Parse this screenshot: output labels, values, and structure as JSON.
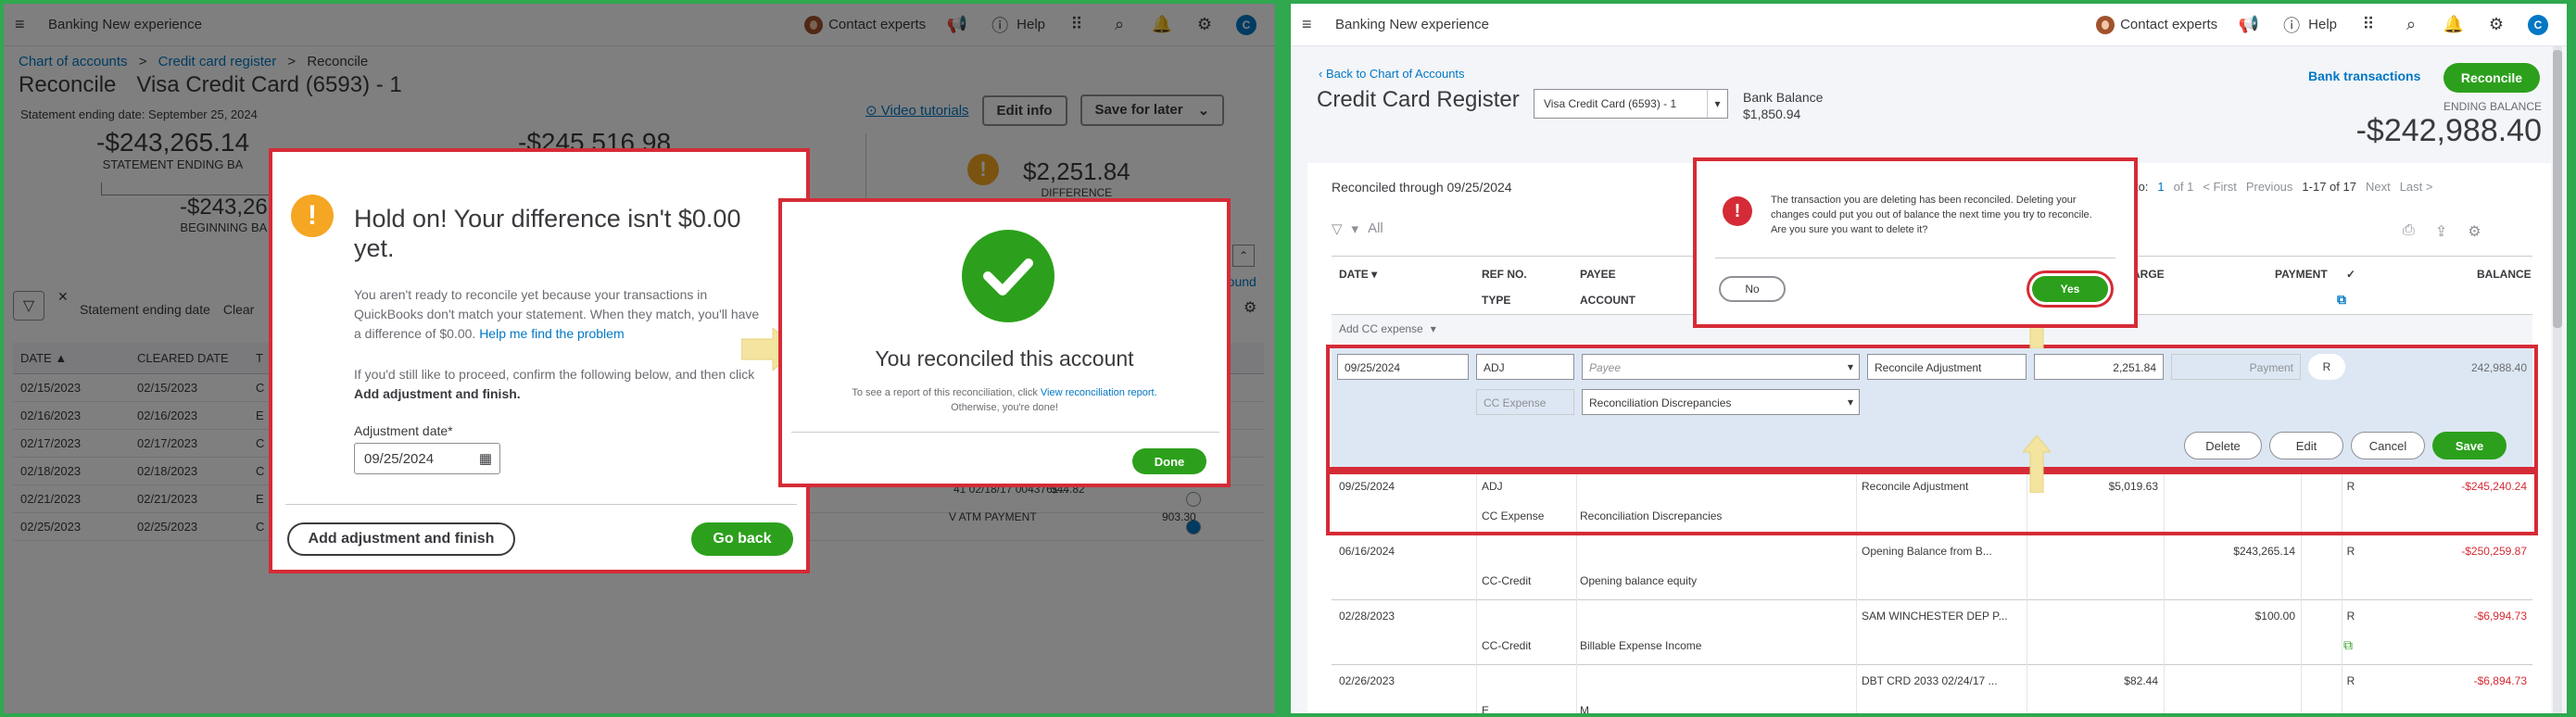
{
  "topbar": {
    "title": "Banking New experience",
    "contact": "Contact experts",
    "help": "Help",
    "avatar": "C"
  },
  "left": {
    "breadcrumb": {
      "a": "Chart of accounts",
      "sep": ">",
      "b": "Credit card register",
      "sep2": ">",
      "c": "Reconcile"
    },
    "title": "Reconcile",
    "account": "Visa Credit Card (6593) - 1",
    "stmt_date": "Statement ending date: September 25, 2024",
    "video": "Video tutorials",
    "edit_info": "Edit info",
    "save_later": "Save for later",
    "stmt_balance": "-$243,265.14",
    "stmt_balance_lbl": "STATEMENT ENDING BA",
    "cleared_balance": "-$245,516.98",
    "beginning": "-$243,26",
    "beginning_lbl": "BEGINNING BA",
    "difference": "$2,251.84",
    "difference_lbl": "DIFFERENCE",
    "filter_chip": "Statement ending date",
    "clear": "Clear",
    "round": "round",
    "cols": [
      "DATE ▲",
      "CLEARED DATE",
      "T"
    ],
    "rows": [
      [
        "02/15/2023",
        "02/15/2023",
        "C"
      ],
      [
        "02/16/2023",
        "02/16/2023",
        "E"
      ],
      [
        "02/17/2023",
        "02/17/2023",
        "C"
      ],
      [
        "02/18/2023",
        "02/18/2023",
        "C"
      ],
      [
        "02/21/2023",
        "02/21/2023",
        "E"
      ],
      [
        "02/25/2023",
        "02/25/2023",
        "C"
      ]
    ],
    "row_extra": [
      {
        "desc": "41 02/18/17 0043761...",
        "amt": "$44.82"
      },
      {
        "desc": "V ATM PAYMENT",
        "amt": "903.30"
      }
    ],
    "modal": {
      "heading": "Hold on! Your difference isn't $0.00 yet.",
      "p1": "You aren't ready to reconcile yet because your transactions in QuickBooks don't match your statement. When they match, you'll have a difference of $0.00.",
      "p1_link": "Help me find the problem",
      "p2a": "If you'd still like to proceed, confirm the following below, and then click",
      "p2b": "Add adjustment and finish.",
      "date_label": "Adjustment date*",
      "date_value": "09/25/2024",
      "btn_add": "Add adjustment and finish",
      "btn_back": "Go back"
    },
    "success": {
      "title": "You reconciled this account",
      "line1": "To see a report of this reconciliation, click",
      "link": "View reconciliation report.",
      "line2": "Otherwise, you're done!",
      "done": "Done"
    }
  },
  "right": {
    "back": "Back to Chart of Accounts",
    "title": "Credit Card Register",
    "account_select": "Visa Credit Card (6593) - 1",
    "bank_balance_lbl": "Bank Balance",
    "bank_balance": "$1,850.94",
    "bank_txn": "Bank transactions",
    "reconcile": "Reconcile",
    "ending_lbl": "ENDING BALANCE",
    "ending": "-$242,988.40",
    "reconciled_through": "Reconciled through 09/25/2024",
    "pager": {
      "goto": "Go to:",
      "page": "1",
      "of": "of 1",
      "first": "< First",
      "prev": "Previous",
      "range": "1-17 of 17",
      "next": "Next",
      "last": "Last >"
    },
    "filter_all": "All",
    "cols": {
      "date": "DATE ▾",
      "type": "TYPE",
      "ref": "REF NO.",
      "payee": "PAYEE",
      "account": "ACCOUNT",
      "charge": "ARGE",
      "payment": "PAYMENT",
      "check": "✓",
      "balance": "BALANCE"
    },
    "add_expense": "Add CC expense",
    "edit_row": {
      "date": "09/25/2024",
      "ref": "ADJ",
      "payee_ph": "Payee",
      "memo": "Reconcile Adjustment",
      "charge": "2,251.84",
      "payment_ph": "Payment",
      "status": "R",
      "balance": "242,988.40",
      "type": "CC Expense",
      "account": "Reconciliation Discrepancies"
    },
    "edit_btns": {
      "delete": "Delete",
      "edit": "Edit",
      "cancel": "Cancel",
      "save": "Save"
    },
    "rows": [
      {
        "date": "09/25/2024",
        "ref": "ADJ",
        "memo": "Reconcile Adjustment",
        "charge": "$5,019.63",
        "payment": "",
        "status": "R",
        "balance": "-$245,240.24",
        "type": "CC Expense",
        "account": "Reconciliation Discrepancies"
      },
      {
        "date": "06/16/2024",
        "ref": "",
        "memo": "Opening Balance from B...",
        "charge": "",
        "payment": "$243,265.14",
        "status": "R",
        "balance": "-$250,259.87",
        "type": "CC-Credit",
        "account": "Opening balance equity"
      },
      {
        "date": "02/28/2023",
        "ref": "",
        "memo": "SAM WINCHESTER DEP P...",
        "charge": "",
        "payment": "$100.00",
        "status": "R",
        "balance": "-$6,994.73",
        "type": "CC-Credit",
        "account": "Billable Expense Income"
      },
      {
        "date": "02/26/2023",
        "ref": "",
        "memo": "DBT CRD 2033 02/24/17 ...",
        "charge": "$82.44",
        "payment": "",
        "status": "R",
        "balance": "-$6,894.73",
        "type": "E",
        "account": "M"
      }
    ],
    "dialog": {
      "msg": "The transaction you are deleting has been reconciled. Deleting your changes could put you out of balance the next time you try to reconcile. Are you sure you want to delete it?",
      "no": "No",
      "yes": "Yes"
    }
  }
}
